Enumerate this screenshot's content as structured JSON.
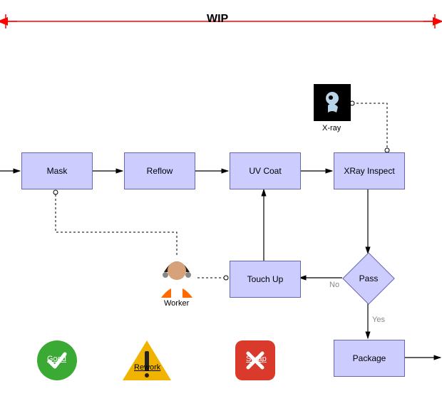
{
  "wip_label": "WIP",
  "nodes": {
    "mask": "Mask",
    "reflow": "Reflow",
    "uvcoat": "UV Coat",
    "xray_inspect": "XRay Inspect",
    "touchup": "Touch Up",
    "pass": "Pass",
    "package": "Package"
  },
  "labels": {
    "xray": "X-ray",
    "worker": "Worker",
    "no": "No",
    "yes": "Yes",
    "good": "Good",
    "rework": "Rework",
    "scrap": "Scrap"
  },
  "colors": {
    "node_fill": "#ccccff",
    "node_border": "#6666aa",
    "arrow": "#000000",
    "wip_line": "#ff0000",
    "good": "#3aaa35",
    "rework": "#f0b400",
    "scrap": "#d93a2b"
  }
}
